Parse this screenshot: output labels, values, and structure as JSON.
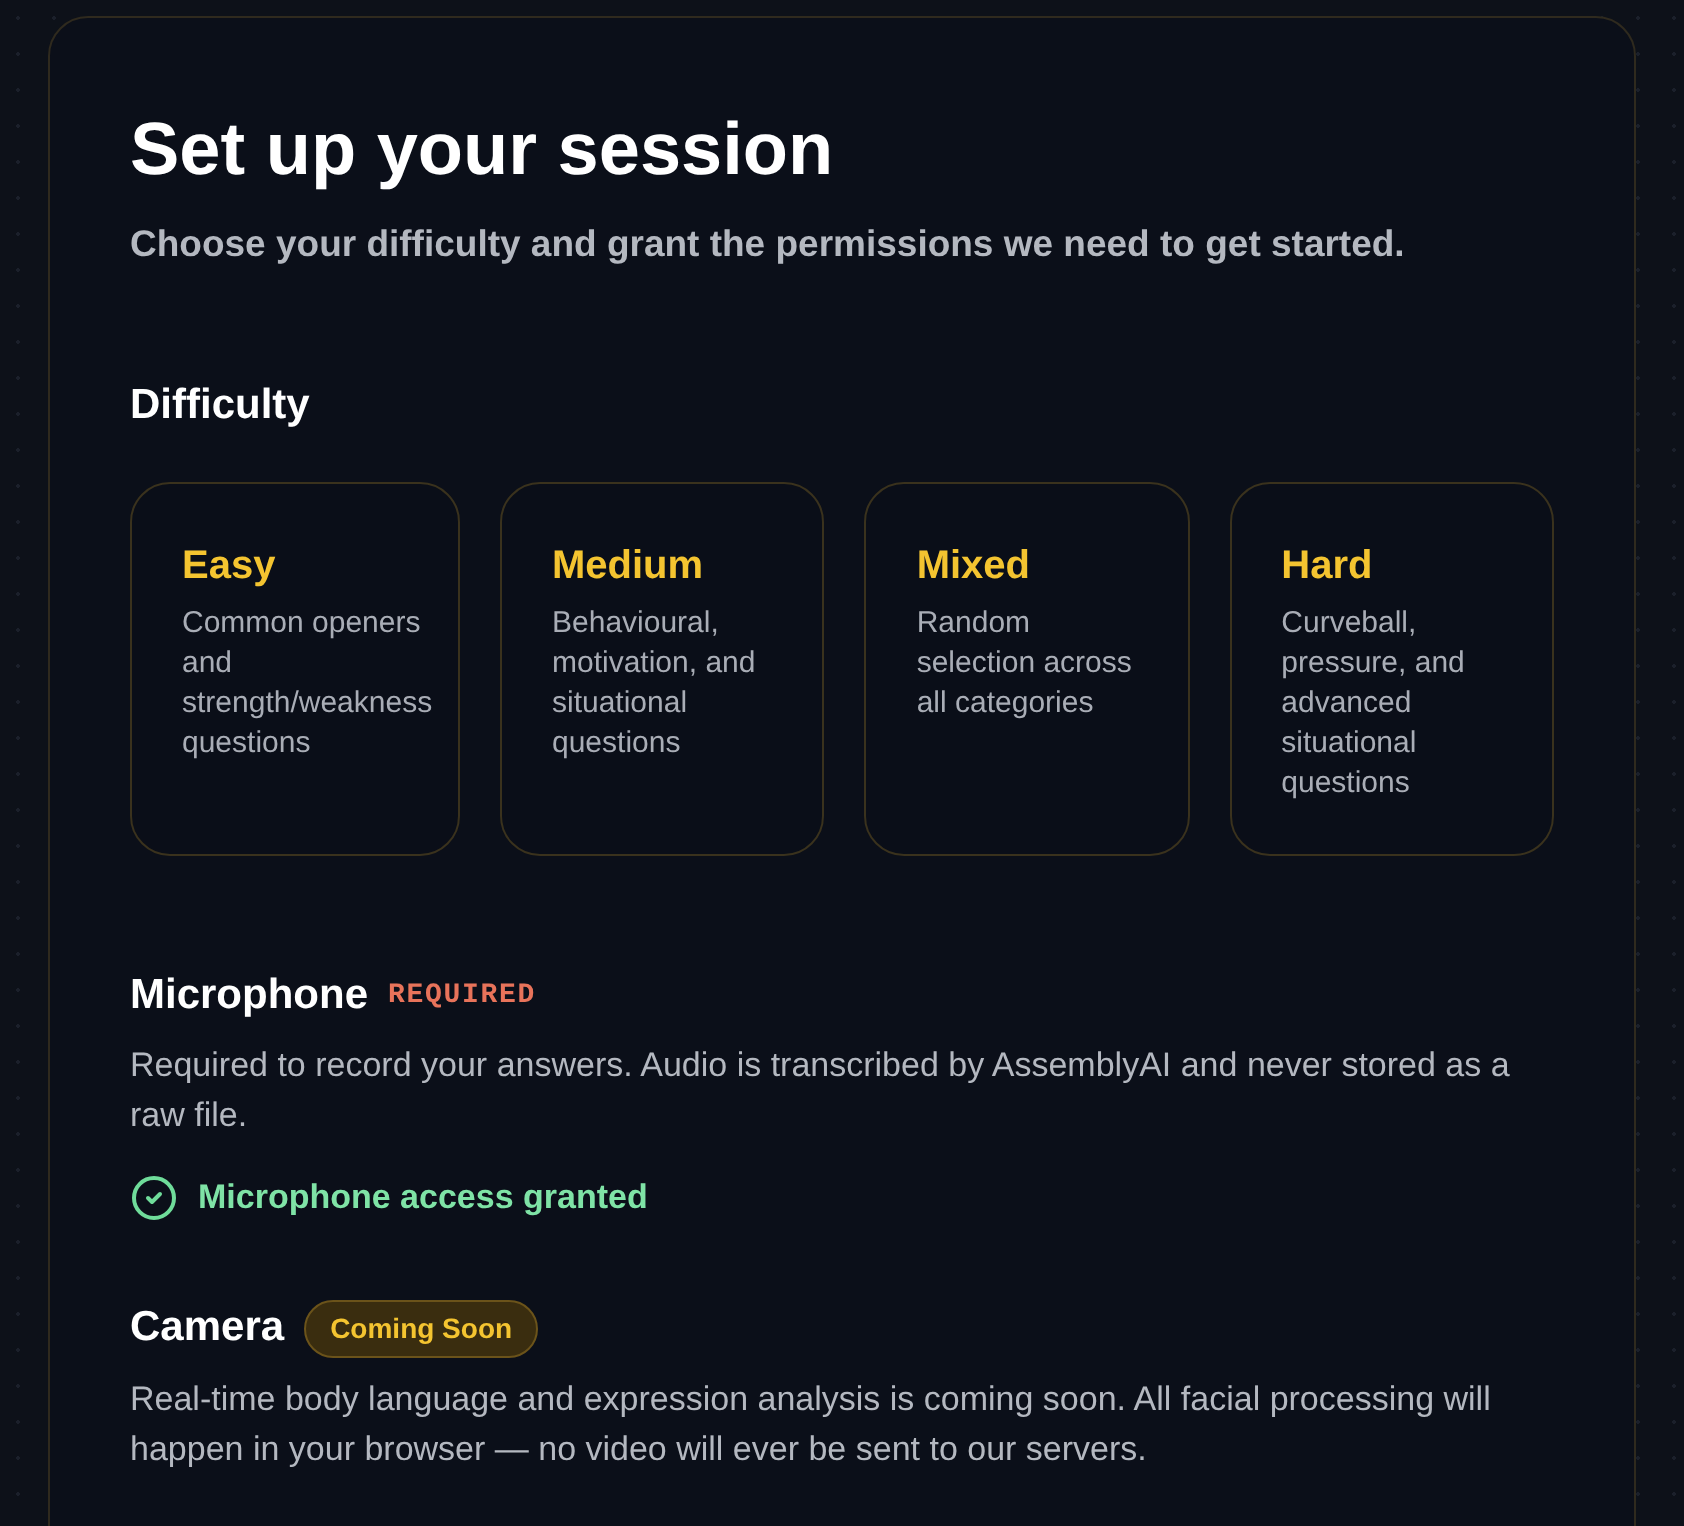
{
  "page": {
    "title": "Set up your session",
    "subtitle": "Choose your difficulty and grant the permissions we need to get started."
  },
  "difficulty": {
    "heading": "Difficulty",
    "options": [
      {
        "label": "Easy",
        "description": "Common openers and strength/weakness questions",
        "selected": false
      },
      {
        "label": "Medium",
        "description": "Behavioural, motivation, and situational questions",
        "selected": false
      },
      {
        "label": "Mixed",
        "description": "Random selection across all categories",
        "selected": false
      },
      {
        "label": "Hard",
        "description": "Curveball, pressure, and advanced situational questions",
        "selected": false
      }
    ]
  },
  "permissions": [
    {
      "name": "Microphone",
      "badge": {
        "kind": "tag",
        "text": "REQUIRED"
      },
      "description": "Required to record your answers. Audio is transcribed by AssemblyAI and never stored as a raw file.",
      "status": {
        "granted": true,
        "text": "Microphone access granted"
      }
    },
    {
      "name": "Camera",
      "badge": {
        "kind": "pill",
        "text": "Coming Soon"
      },
      "description": "Real-time body language and expression analysis is coming soon. All facial processing will happen in your browser — no video will ever be sent to our servers."
    }
  ]
}
